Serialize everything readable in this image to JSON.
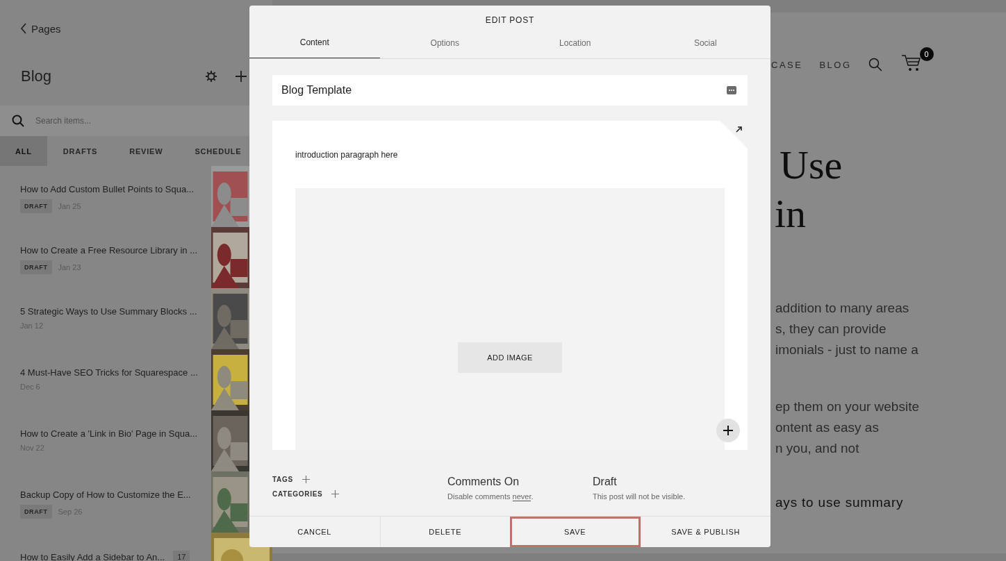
{
  "sidebar": {
    "back_link": "Pages",
    "title": "Blog",
    "search": {
      "placeholder": "Search items..."
    },
    "filters": [
      {
        "label": "ALL",
        "selected": true
      },
      {
        "label": "DRAFTS",
        "selected": false
      },
      {
        "label": "REVIEW",
        "selected": false
      },
      {
        "label": "SCHEDULE",
        "selected": false
      }
    ],
    "posts": [
      {
        "title": "How to Add Custom Bullet Points to Squa...",
        "status": "DRAFT",
        "date": "Jan 25"
      },
      {
        "title": "How to Create a Free Resource Library in ...",
        "status": "DRAFT",
        "date": "Jan 23"
      },
      {
        "title": "5 Strategic Ways to Use Summary Blocks ...",
        "date": "Jan 12"
      },
      {
        "title": "4 Must-Have SEO Tricks for Squarespace ...",
        "date": "Dec 6"
      },
      {
        "title": "How to Create a 'Link in Bio' Page in Squa...",
        "date": "Nov 22"
      },
      {
        "title": "Backup Copy of How to Customize the E...",
        "status": "DRAFT",
        "date": "Sep 26"
      },
      {
        "title": "How to Easily Add a Sidebar to An...",
        "count": "17"
      }
    ]
  },
  "preview": {
    "nav": [
      "CASE",
      "BLOG"
    ],
    "cart_count": "0",
    "heading_lines": [
      "Use",
      "in"
    ],
    "paragraphs": [
      [
        "addition to many areas",
        "s, they can provide",
        "imonials - just to name a"
      ],
      [
        "ep them on your website",
        "ontent as easy as",
        "n you, and not"
      ]
    ],
    "subheading": "ays to use summary"
  },
  "modal": {
    "title": "EDIT POST",
    "tabs": [
      {
        "label": "Content",
        "selected": true
      },
      {
        "label": "Options",
        "selected": false
      },
      {
        "label": "Location",
        "selected": false
      },
      {
        "label": "Social",
        "selected": false
      }
    ],
    "post_title": "Blog Template",
    "body_text": "introduction paragraph here",
    "add_image": "ADD IMAGE",
    "tags_label": "TAGS",
    "categories_label": "CATEGORIES",
    "comments": {
      "title": "Comments On",
      "text_before": "Disable comments",
      "link": "never",
      "text_after": "."
    },
    "status": {
      "title": "Draft",
      "note": "This post will not be visible."
    },
    "buttons": [
      {
        "label": "CANCEL",
        "highlighted": false
      },
      {
        "label": "DELETE",
        "highlighted": false
      },
      {
        "label": "SAVE",
        "highlighted": true
      },
      {
        "label": "SAVE & PUBLISH",
        "highlighted": false
      }
    ]
  }
}
